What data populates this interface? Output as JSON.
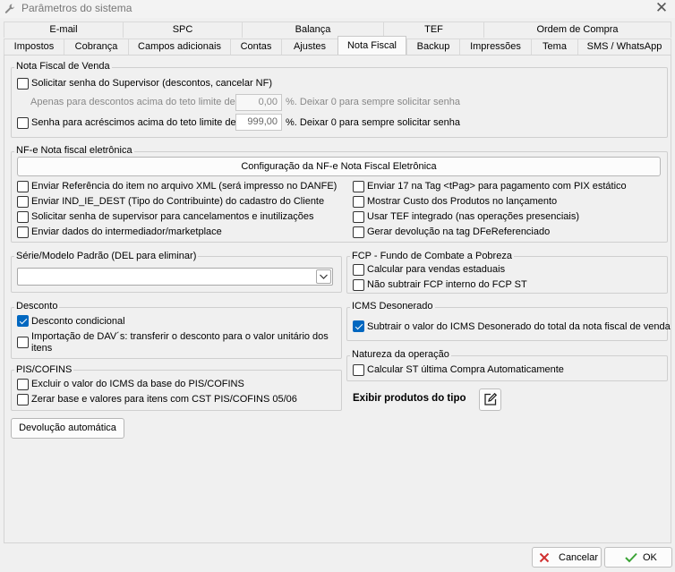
{
  "window": {
    "title": "Parâmetros do sistema",
    "close_glyph": "✕"
  },
  "tabs_row1": [
    "E-mail",
    "SPC",
    "Balança",
    "TEF",
    "Ordem de Compra"
  ],
  "tabs_row2": [
    "Impostos",
    "Cobrança",
    "Campos adicionais",
    "Contas",
    "Ajustes",
    "Nota Fiscal",
    "Backup",
    "Impressões",
    "Tema",
    "SMS / WhatsApp"
  ],
  "active_tab": "Nota Fiscal",
  "nota_fiscal_venda": {
    "legend": "Nota Fiscal de Venda",
    "solicitar_senha": {
      "label": "Solicitar senha do Supervisor (descontos, cancelar NF)",
      "checked": false
    },
    "apenas_label": "Apenas para descontos acima do teto limite de:",
    "apenas_value": "0,00",
    "apenas_suffix": "%. Deixar 0 para sempre solicitar senha",
    "senha_acrescimos": {
      "label": "Senha para acréscimos acima do teto limite de:",
      "checked": false
    },
    "acrescimos_value": "999,00",
    "acrescimos_suffix": "%. Deixar 0 para sempre solicitar senha"
  },
  "nfe": {
    "legend": "NF-e Nota fiscal eletrônica",
    "config_button": "Configuração da NF-e Nota Fiscal Eletrônica",
    "left": [
      {
        "label": "Enviar Referência do item no arquivo XML (será impresso no DANFE)",
        "checked": false
      },
      {
        "label": "Enviar IND_IE_DEST (Tipo do Contribuinte) do cadastro do Cliente",
        "checked": false
      },
      {
        "label": "Solicitar senha de supervisor para cancelamentos e inutilizações",
        "checked": false
      },
      {
        "label": "Enviar dados do intermediador/marketplace",
        "checked": false
      }
    ],
    "right": [
      {
        "label": "Enviar 17 na Tag <tPag> para pagamento com PIX estático",
        "checked": false
      },
      {
        "label": "Mostrar Custo dos Produtos no lançamento",
        "checked": false
      },
      {
        "label": "Usar TEF integrado (nas operações presenciais)",
        "checked": false
      },
      {
        "label": "Gerar devolução na tag DFeReferenciado",
        "checked": false
      }
    ]
  },
  "serie": {
    "legend": "Série/Modelo Padrão (DEL para eliminar)",
    "value": ""
  },
  "fcp": {
    "legend": "FCP - Fundo de Combate a Pobreza",
    "items": [
      {
        "label": "Calcular para vendas estaduais",
        "checked": false
      },
      {
        "label": "Não subtrair FCP interno do FCP ST",
        "checked": false
      }
    ]
  },
  "desconto": {
    "legend": "Desconto",
    "condicional": {
      "label": "Desconto condicional",
      "checked": true
    },
    "importacao_line1": "Importação de DAV´s: transferir o desconto para o valor unitário dos",
    "importacao_line2": "itens",
    "importacao_checked": false
  },
  "icms": {
    "legend": "ICMS Desonerado",
    "item": {
      "label": "Subtrair o valor do ICMS Desonerado do total da nota fiscal de venda",
      "checked": true
    }
  },
  "pis": {
    "legend": "PIS/COFINS",
    "items": [
      {
        "label": "Excluir o valor do ICMS da base do PIS/COFINS",
        "checked": false
      },
      {
        "label": "Zerar base e valores para itens com CST PIS/COFINS 05/06",
        "checked": false
      }
    ]
  },
  "natureza": {
    "legend": "Natureza da operação",
    "item": {
      "label": "Calcular ST última Compra Automaticamente",
      "checked": false
    }
  },
  "exibir_label": "Exibir produtos do tipo",
  "devolucao_button": "Devolução automática",
  "cancel_button": "Cancelar",
  "ok_button": "OK",
  "colors": {
    "accent": "#0067c0",
    "cancel_icon": "#d03030",
    "ok_icon": "#3aa335"
  }
}
